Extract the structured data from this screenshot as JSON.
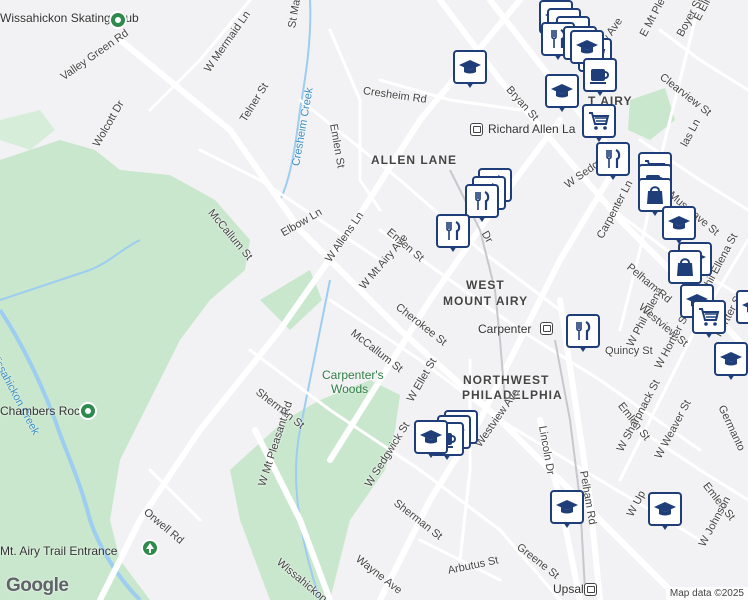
{
  "map": {
    "neighborhoods": [
      "ALLEN LANE",
      "WEST",
      "MOUNT AIRY",
      "NORTHWEST",
      "PHILADELPHIA"
    ],
    "neighborhood_fragment": "T AIRY",
    "parks": [
      "Carpenter's",
      "Woods"
    ],
    "creeks": [
      "Cresheim Creek",
      "Wissahickon Creek"
    ],
    "places": [
      {
        "name": "Wissahickon Skating Club",
        "icon": "place-pin-icon"
      },
      {
        "name": "Chambers Rock",
        "icon": "place-pin-icon"
      },
      {
        "name": "Mt. Airy Trail Entrance",
        "icon": "trailhead-icon"
      }
    ],
    "stations": [
      {
        "name": "Richard Allen La",
        "icon": "train-station-icon"
      },
      {
        "name": "Carpenter",
        "icon": "train-station-icon"
      },
      {
        "name": "Upsal",
        "icon": "train-station-icon"
      }
    ],
    "streets": [
      "Valley Green Rd",
      "W Mermaid Ln",
      "St Martins",
      "Telner St",
      "Wolcott Dr",
      "Cresheim Rd",
      "Emlen St",
      "Bryan St",
      "McCallum St",
      "Elbow Ln",
      "W Allens Ln",
      "Emlen St",
      "W Mt Airy Ave",
      "Cherokee St",
      "McCallum St",
      "Sherman St",
      "W Mt Pleasant Rd",
      "W Ellet St",
      "Westview Ave",
      "W Sedgwick St",
      "Sherman St",
      "Lincoln Dr",
      "Pelham Rd",
      "Orwell Rd",
      "Wissahickon",
      "Wayne Ave",
      "Arbutus St",
      "Greene St",
      "Emlen St",
      "W Sharpnack St",
      "W Weaver St",
      "Emlen St",
      "W Johnson",
      "Quincy St",
      "W Phil Ellena",
      "W Hortter St",
      "Westview St",
      "Pelham Rd",
      "Carpenter Ln",
      "Musgrave St",
      "W Sedg",
      "Clearview St",
      "Boyer St",
      "E Ellet S",
      "E Mt Pleasant",
      "ew Ave",
      "W Phil Ellena St",
      "Hortter St",
      "Germanto",
      "Dr",
      "W Up",
      "las Ln"
    ],
    "marker_categories": [
      "education",
      "cafe",
      "restaurant",
      "grocery",
      "shopping"
    ]
  },
  "attribution": {
    "logo": "Google",
    "map_data": "Map data ©2025"
  }
}
